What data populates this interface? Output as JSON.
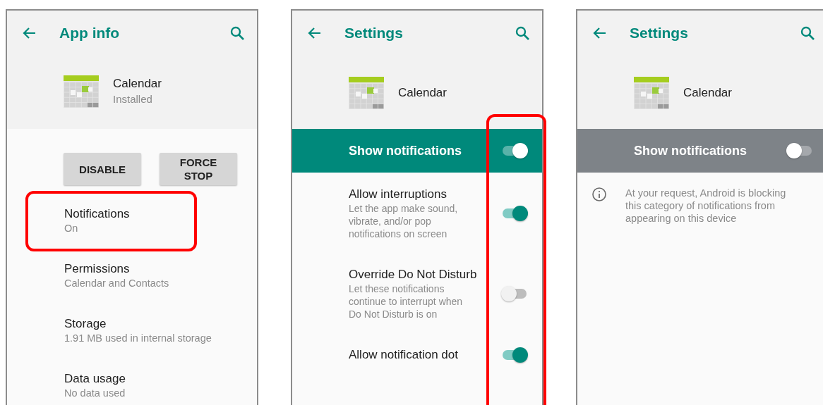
{
  "screens": [
    {
      "title": "App info",
      "app": {
        "name": "Calendar",
        "status": "Installed"
      },
      "buttons": [
        "DISABLE",
        "FORCE STOP"
      ],
      "items": [
        {
          "kind": "link",
          "title": "Notifications",
          "summary": "On",
          "highlighted": true
        },
        {
          "kind": "link",
          "title": "Permissions",
          "summary": "Calendar and Contacts",
          "highlighted": false
        },
        {
          "kind": "link",
          "title": "Storage",
          "summary": "1.91 MB used in internal storage",
          "highlighted": false
        },
        {
          "kind": "link",
          "title": "Data usage",
          "summary": "No data used",
          "highlighted": false
        }
      ]
    },
    {
      "title": "Settings",
      "app": {
        "name": "Calendar"
      },
      "banner": {
        "label": "Show notifications",
        "on": true
      },
      "toggles_highlighted": true,
      "items": [
        {
          "kind": "toggle",
          "title": "Allow interruptions",
          "summary": "Let the app make sound, vibrate, and/or pop notifications on screen",
          "on": true
        },
        {
          "kind": "toggle",
          "title": "Override Do Not Disturb",
          "summary": "Let these notifications continue to interrupt when Do Not Disturb is on",
          "on": false
        },
        {
          "kind": "toggle",
          "title": "Allow notification dot",
          "on": true
        }
      ]
    },
    {
      "title": "Settings",
      "app": {
        "name": "Calendar"
      },
      "banner": {
        "label": "Show notifications",
        "on": false
      },
      "toggles_highlighted": false,
      "note": "At your request, Android is blocking this category of notifications from appearing on this device"
    }
  ]
}
